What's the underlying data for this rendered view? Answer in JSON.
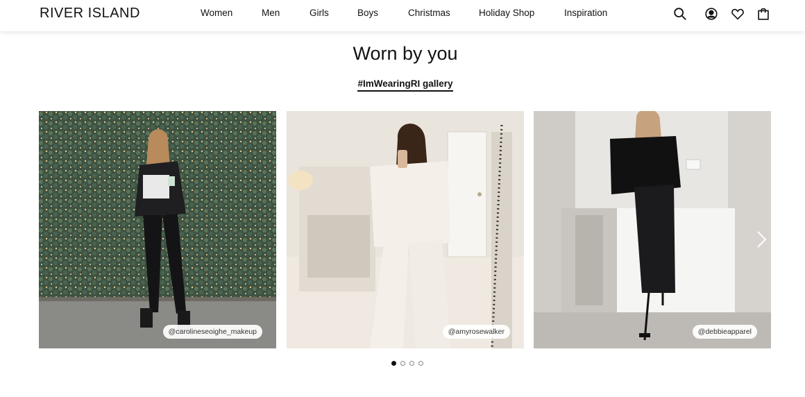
{
  "header": {
    "logo": "RIVER ISLAND",
    "nav": [
      "Women",
      "Men",
      "Girls",
      "Boys",
      "Christmas",
      "Holiday Shop",
      "Inspiration"
    ],
    "icons": [
      "search-icon",
      "account-icon",
      "wishlist-heart-icon",
      "bag-icon"
    ]
  },
  "section": {
    "title": "Worn by you",
    "gallery_link": "#ImWearingRI gallery"
  },
  "carousel": {
    "cards": [
      {
        "handle": "@carolineseoighe_makeup"
      },
      {
        "handle": "@amyrosewalker"
      },
      {
        "handle": "@debbieapparel"
      }
    ],
    "dots_count": 4,
    "active_dot": 1
  }
}
